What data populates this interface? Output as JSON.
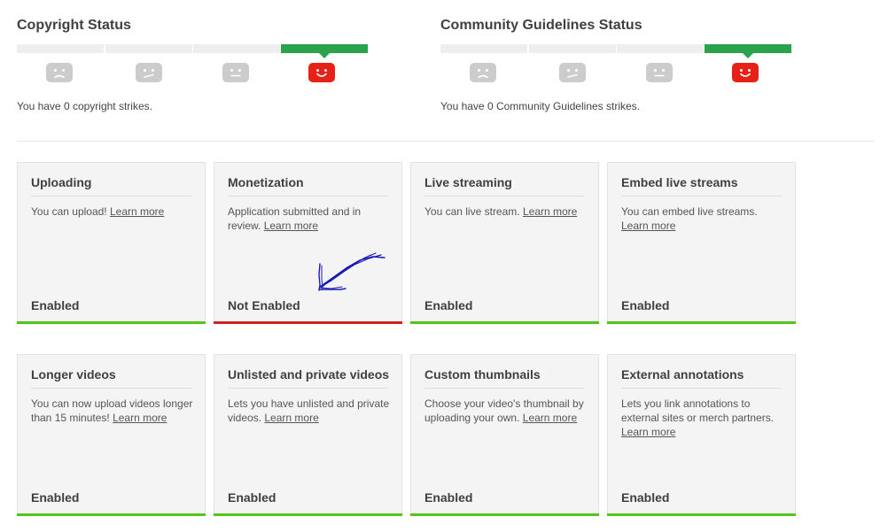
{
  "copyright": {
    "title": "Copyright Status",
    "message": "You have 0 copyright strikes."
  },
  "community": {
    "title": "Community Guidelines Status",
    "message": "You have 0 Community Guidelines strikes."
  },
  "strike_meter": {
    "levels": [
      "very-sad-face-icon",
      "sad-face-icon",
      "neutral-face-icon",
      "happy-face-icon"
    ],
    "active_level": 3,
    "inactive_color": "#cccccc",
    "active_color": "#e62117",
    "bar_active_color": "#2ba24c"
  },
  "learn_more_label": "Learn more",
  "features": [
    {
      "title": "Uploading",
      "desc": "You can upload!",
      "state": "Enabled",
      "enabled": true
    },
    {
      "title": "Monetization",
      "desc": "Application submitted and in review.",
      "state": "Not Enabled",
      "enabled": false
    },
    {
      "title": "Live streaming",
      "desc": "You can live stream.",
      "state": "Enabled",
      "enabled": true
    },
    {
      "title": "Embed live streams",
      "desc": "You can embed live streams.",
      "state": "Enabled",
      "enabled": true
    },
    {
      "title": "Longer videos",
      "desc": "You can now upload videos longer than 15 minutes!",
      "state": "Enabled",
      "enabled": true
    },
    {
      "title": "Unlisted and private videos",
      "desc": "Lets you have unlisted and private videos.",
      "state": "Enabled",
      "enabled": true
    },
    {
      "title": "Custom thumbnails",
      "desc": "Choose your video's thumbnail by uploading your own.",
      "state": "Enabled",
      "enabled": true
    },
    {
      "title": "External annotations",
      "desc": "Lets you link annotations to external sites or merch partners.",
      "state": "Enabled",
      "enabled": true
    }
  ],
  "colors": {
    "enabled": "#52c41a",
    "not_enabled": "#cc2424",
    "annotation": "#1a1ab8"
  }
}
